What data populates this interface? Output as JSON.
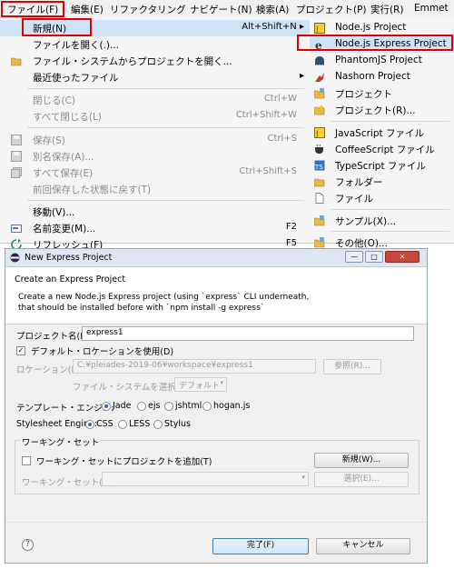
{
  "menubar": {
    "items": [
      "ファイル(F)",
      "編集(E)",
      "リファクタリング",
      "ナビゲート(N)",
      "検索(A)",
      "プロジェクト(P)",
      "実行(R)",
      "Emmet"
    ]
  },
  "file_menu": {
    "items": [
      {
        "label": "新規(N)",
        "shortcut": "Alt+Shift+N ▸"
      },
      {
        "label": "ファイルを開く(.)...",
        "shortcut": ""
      },
      {
        "label": "ファイル・システムからプロジェクトを開く...",
        "shortcut": ""
      },
      {
        "label": "最近使ったファイル",
        "shortcut": "▸"
      },
      {
        "label": "閉じる(C)",
        "shortcut": "Ctrl+W"
      },
      {
        "label": "すべて閉じる(L)",
        "shortcut": "Ctrl+Shift+W"
      },
      {
        "label": "保存(S)",
        "shortcut": "Ctrl+S"
      },
      {
        "label": "別名保存(A)...",
        "shortcut": ""
      },
      {
        "label": "すべて保存(E)",
        "shortcut": "Ctrl+Shift+S"
      },
      {
        "label": "前回保存した状態に戻す(T)",
        "shortcut": ""
      },
      {
        "label": "移動(V)...",
        "shortcut": ""
      },
      {
        "label": "名前変更(M)...",
        "shortcut": "F2"
      },
      {
        "label": "リフレッシュ(F)",
        "shortcut": "F5"
      }
    ]
  },
  "new_submenu": {
    "items": [
      {
        "label": "Node.js Project",
        "icon": "nodejs-icon"
      },
      {
        "label": "Node.js Express Project",
        "icon": "express-icon"
      },
      {
        "label": "PhantomJS Project",
        "icon": "phantom-icon"
      },
      {
        "label": "Nashorn Project",
        "icon": "nashorn-icon"
      },
      {
        "label": "プロジェクト",
        "icon": "project-icon"
      },
      {
        "label": "プロジェクト(R)...",
        "icon": "project-wizard-icon"
      },
      {
        "label": "JavaScript ファイル",
        "icon": "js-file-icon"
      },
      {
        "label": "CoffeeScript ファイル",
        "icon": "coffee-icon"
      },
      {
        "label": "TypeScript ファイル",
        "icon": "ts-file-icon"
      },
      {
        "label": "フォルダー",
        "icon": "folder-icon"
      },
      {
        "label": "ファイル",
        "icon": "file-icon"
      },
      {
        "label": "サンプル(X)...",
        "icon": "sample-icon"
      },
      {
        "label": "その他(O)...",
        "icon": "other-icon"
      }
    ]
  },
  "dialog": {
    "title": "New Express Project",
    "header_title": "Create an Express Project",
    "header_desc_1": "Create a new Node.js Express project (using `express` CLI underneath,",
    "header_desc_2": "that should be installed before with `npm install -g express`",
    "project_name_label": "プロジェクト名(P):",
    "project_name_value": "express1",
    "default_location_label": "デフォルト・ロケーションを使用(D)",
    "location_label": "ロケーション(L):",
    "location_value": "C:¥pleiades-2019-06¥workspace¥express1",
    "browse_label": "参照(R)...",
    "filesystem_label": "ファイル・システムを選択(Y):",
    "filesystem_value": "デフォルト",
    "template_engine_label": "テンプレート・エンジン:",
    "template_options": [
      "Jade",
      "ejs",
      "jshtml",
      "hogan.js"
    ],
    "stylesheet_label": "Stylesheet Engine:",
    "stylesheet_options": [
      "CSS",
      "LESS",
      "Stylus"
    ],
    "working_set_group": "ワーキング・セット",
    "add_working_set_label": "ワーキング・セットにプロジェクトを追加(T)",
    "new_button": "新規(W)...",
    "working_set_label": "ワーキング・セット(O):",
    "select_button": "選択(E)...",
    "finish_button": "完了(F)",
    "cancel_button": "キャンセル"
  }
}
